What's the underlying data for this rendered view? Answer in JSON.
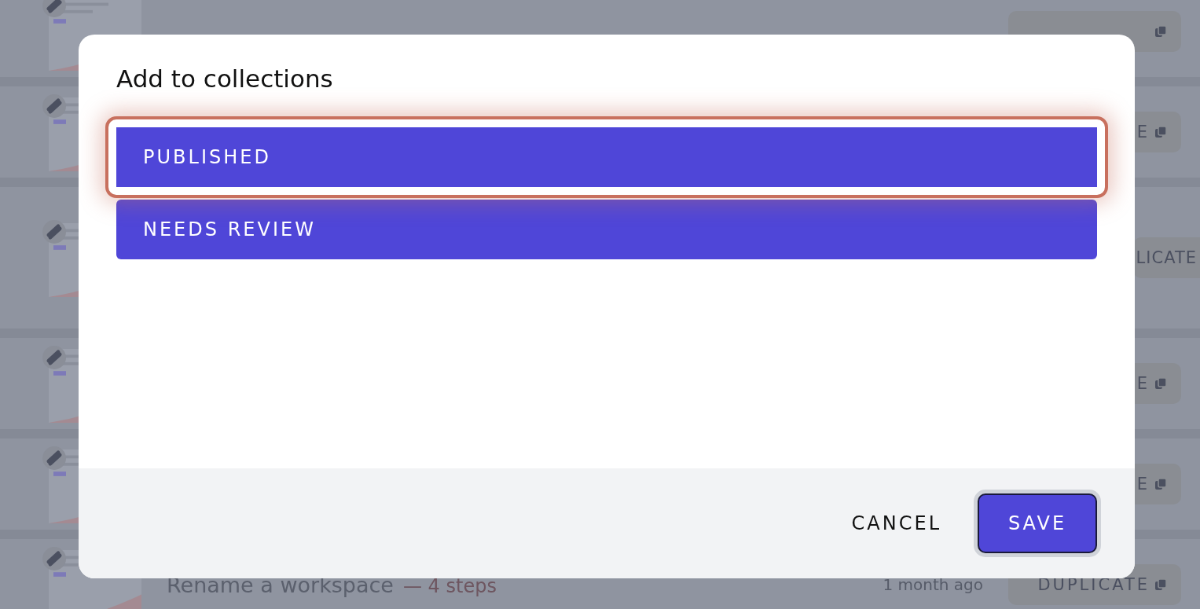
{
  "background_list": [
    {
      "copy_icon": true
    },
    {
      "duplicate": "E",
      "copy_icon": true
    },
    {
      "duplicate": "LICATE",
      "copy_icon": false
    },
    {
      "duplicate": "E",
      "copy_icon": true
    },
    {
      "duplicate": "E",
      "copy_icon": true
    },
    {
      "title": "Rename a workspace",
      "steps": "— 4 steps",
      "age": "1 month ago",
      "duplicate": "DUPLICATE",
      "copy_icon": true
    }
  ],
  "dialog": {
    "title": "Add to collections",
    "collections": [
      {
        "label": "PUBLISHED",
        "selected": true
      },
      {
        "label": "NEEDS REVIEW",
        "selected": false
      }
    ],
    "buttons": [
      {
        "label": "CANCEL",
        "kind": "text"
      },
      {
        "label": "SAVE",
        "kind": "primary"
      }
    ]
  }
}
